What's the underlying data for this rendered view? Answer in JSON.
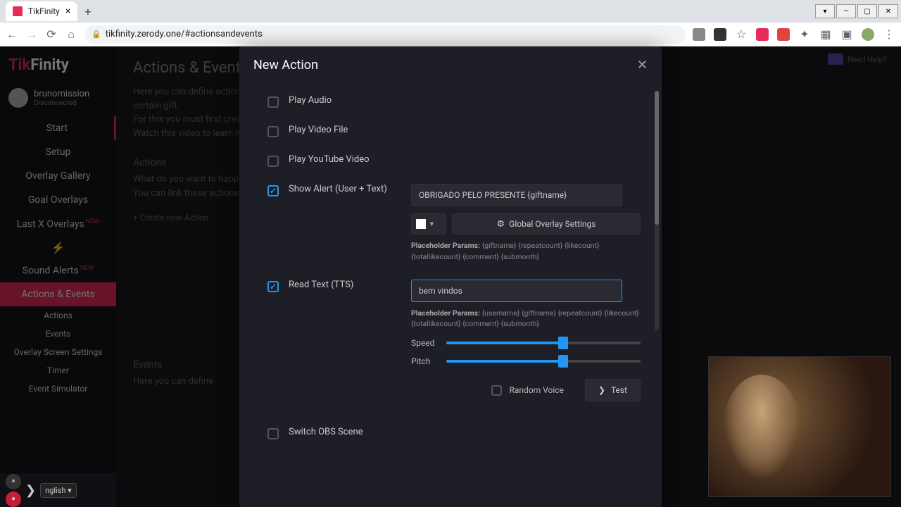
{
  "browser": {
    "tab_title": "TikFinity",
    "url": "tikfinity.zerody.one/#actionsandevents"
  },
  "logo": {
    "part1": "Tik",
    "part2": "Finity"
  },
  "profile": {
    "name": "brunomission",
    "status": "Disconnected"
  },
  "nav": {
    "start": "Start",
    "setup": "Setup",
    "overlay_gallery": "Overlay Gallery",
    "goal_overlays": "Goal Overlays",
    "last_x": "Last X Overlays",
    "last_x_badge": "NEW",
    "sound_alerts": "Sound Alerts",
    "sound_alerts_badge": "NEW",
    "actions_events": "Actions & Events",
    "sub_actions": "Actions",
    "sub_events": "Events",
    "sub_overlay_screen": "Overlay Screen Settings",
    "sub_timer": "Timer",
    "sub_event_sim": "Event Simulator"
  },
  "page": {
    "title": "Actions & Events",
    "desc1": "Here you can define actions and link them to certain events. An action would be for example to play an animation on a certain gift.",
    "desc2": "For this you must first create an action and then an event. A connection between OBS and TikFinity is not required.",
    "desc3": "Watch this video to learn how to create an event.",
    "section_actions": "Actions",
    "actions_desc1": "What do you want to happen when a certain event occurs?",
    "actions_desc2": "You can link these actions to events below.",
    "create_action": "+  Create new Action",
    "section_events": "Events",
    "events_desc": "Here you can define",
    "help": "Need Help?"
  },
  "modal": {
    "title": "New Action",
    "close": "✕",
    "opt_play_audio": "Play Audio",
    "opt_play_video": "Play Video File",
    "opt_play_youtube": "Play YouTube Video",
    "opt_show_alert": "Show Alert (User + Text)",
    "alert_value": "OBRIGADO PELO PRESENTE {giftname}",
    "global_overlay": "Global Overlay Settings",
    "placeholder_label": "Placeholder Params:",
    "alert_placeholders": "{giftname} {repeatcount} {likecount} {totallikecount} {comment} {submonth}",
    "opt_read_text": "Read Text (TTS)",
    "tts_value": "bem vindos",
    "tts_placeholders": "{username} {giftname} {repeatcount} {likecount} {totallikecount} {comment} {submonth}",
    "speed": "Speed",
    "pitch": "Pitch",
    "random_voice": "Random Voice",
    "test": "Test",
    "opt_switch_obs": "Switch OBS Scene"
  },
  "lang": "nglish ▾"
}
